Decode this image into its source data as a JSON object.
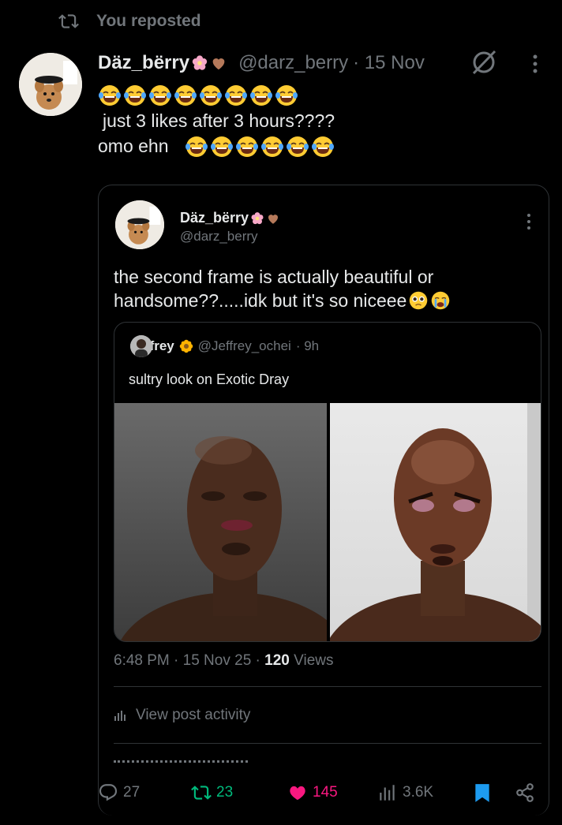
{
  "repost": {
    "label": "You reposted"
  },
  "post": {
    "display_name": "Däz_bërry",
    "handle": "@darz_berry",
    "date": "· 15 Nov",
    "emoji_line_count": 8,
    "line1": "just 3 likes after 3 hours????",
    "line2": "omo ehn",
    "line2_emoji_count": 6
  },
  "quote": {
    "display_name": "Däz_bërry",
    "handle": "@darz_berry",
    "text_line1": "the second frame is actually beautiful or",
    "text_line2": "handsome??.....idk but it's so niceee"
  },
  "inner": {
    "display_name": "Jeffrey",
    "handle": "@Jeffrey_ochei",
    "age": "· 9h",
    "text": "sultry look on Exotic Dray"
  },
  "meta": {
    "time": "6:48 PM · 15 Nov 25 · ",
    "views": "120",
    "views_label": " Views"
  },
  "activity": {
    "label": "View post activity"
  },
  "actions": {
    "replies": "27",
    "reposts": "23",
    "likes": "145",
    "views": "3.6K"
  },
  "colors": {
    "repost_green": "#00ba7c",
    "like_pink": "#f91880",
    "bookmark_blue": "#1d9bf0",
    "muted": "#71767b"
  },
  "icons": [
    "repost-icon",
    "flower-icon",
    "heart-emoji-icon",
    "grok-icon",
    "more-icon",
    "laugh-cry-emoji",
    "pleading-emoji",
    "crying-emoji",
    "sunflower-icon",
    "chart-icon",
    "reply-icon",
    "like-icon",
    "views-icon",
    "bookmark-icon",
    "share-icon"
  ]
}
